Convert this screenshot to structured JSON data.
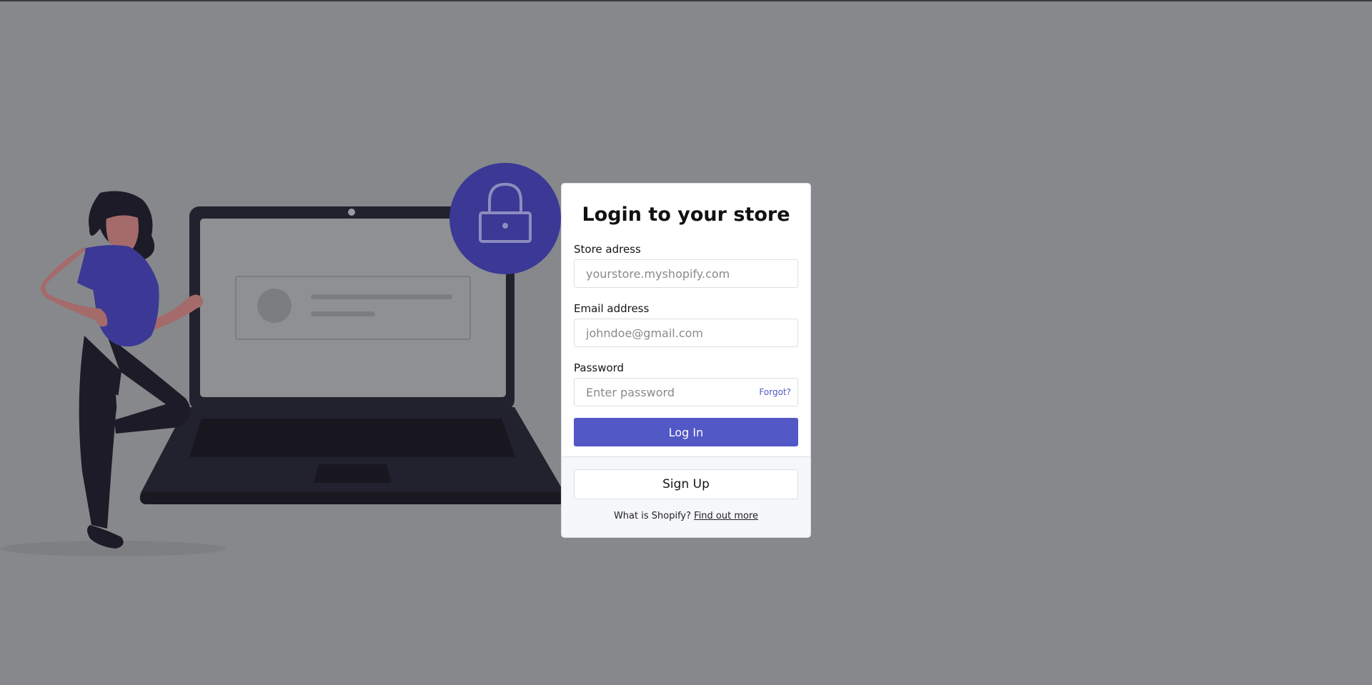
{
  "colors": {
    "overlay_background": "#87888b",
    "accent": "#5258c6",
    "lock_circle": "#3b3995",
    "laptop": "#22212e",
    "shirt": "#3b3995",
    "skin": "#a56a6a",
    "hair": "#1c1b27"
  },
  "illustration": {
    "icons": [
      "woman-figure",
      "laptop",
      "lock-icon",
      "profile-card-placeholder"
    ]
  },
  "login_card": {
    "title": "Login to your store",
    "store": {
      "label": "Store adress",
      "placeholder": "yourstore.myshopify.com",
      "value": ""
    },
    "email": {
      "label": "Email address",
      "placeholder": "johndoe@gmail.com",
      "value": ""
    },
    "password": {
      "label": "Password",
      "placeholder": "Enter password",
      "value": "",
      "forgot_link": "Forgot?"
    },
    "login_button": "Log In",
    "signup_button": "Sign Up",
    "about_text": "What is Shopify?",
    "about_link": "Find out more"
  }
}
